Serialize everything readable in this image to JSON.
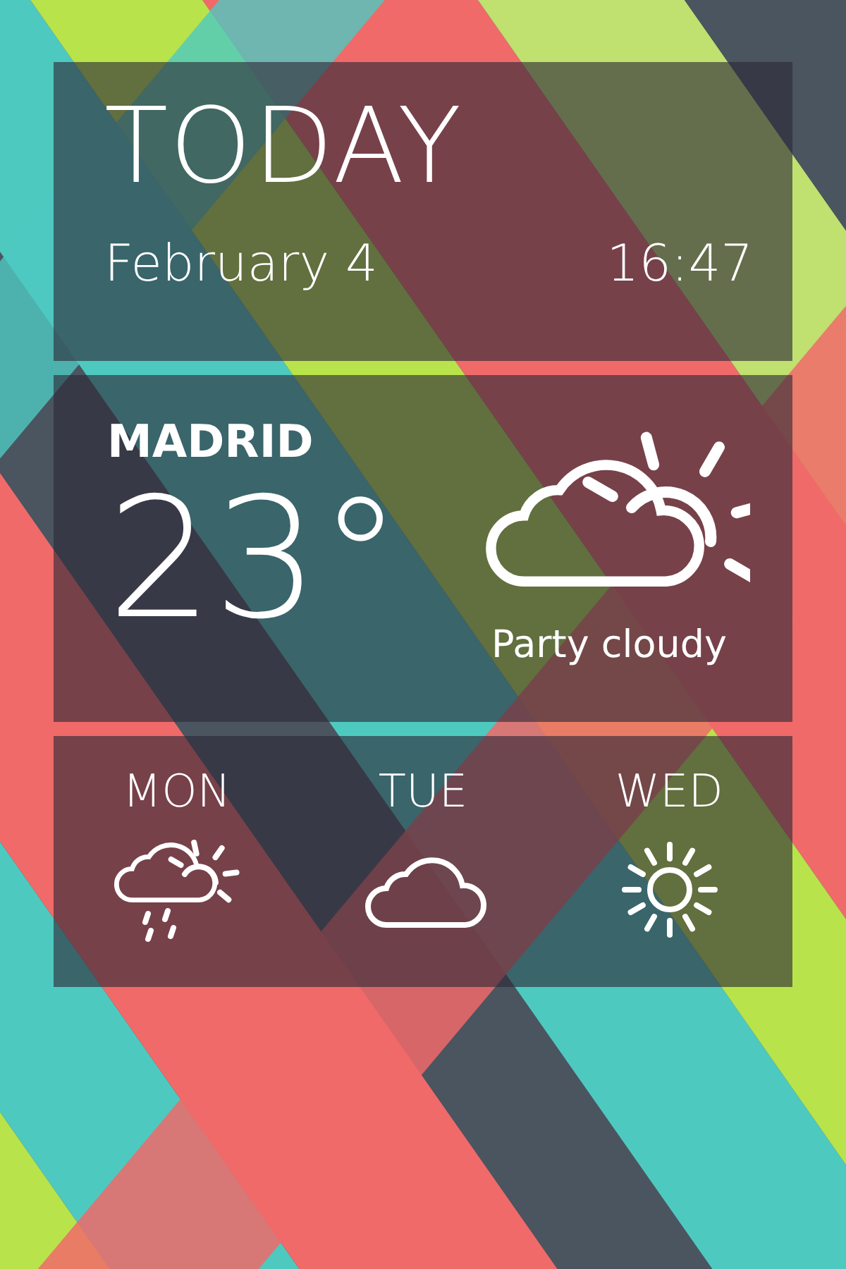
{
  "header": {
    "title": "TODAY",
    "date": "February 4",
    "time": "16:47"
  },
  "current": {
    "city": "MADRID",
    "temperature": "23°",
    "condition": "Party cloudy",
    "kind": "cloud-sun"
  },
  "forecast": [
    {
      "day": "MON",
      "kind": "rain-sun"
    },
    {
      "day": "TUE",
      "kind": "cloud"
    },
    {
      "day": "WED",
      "kind": "sun"
    }
  ]
}
